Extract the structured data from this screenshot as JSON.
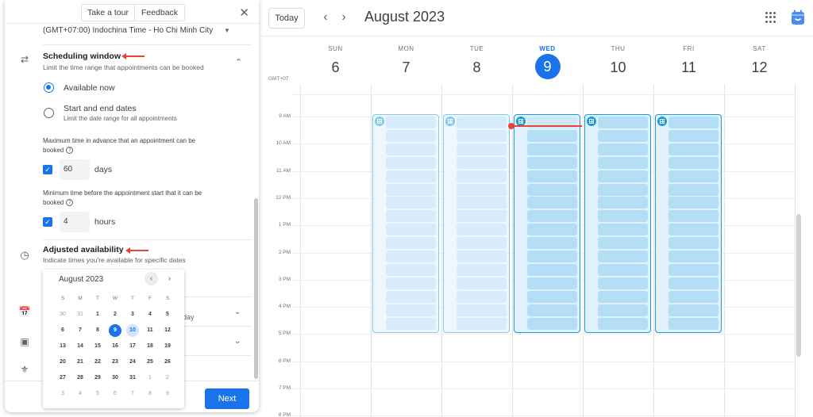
{
  "calendar": {
    "today_label": "Today",
    "prev_icon": "chevron-left-icon",
    "next_icon": "chevron-right-icon",
    "month_title": "August 2023",
    "apps_icon": "apps-grid-icon",
    "logo_icon": "calendar-logo-icon",
    "timezone": "GMT+07",
    "days": [
      {
        "dow": "SUN",
        "date": "6",
        "today": false
      },
      {
        "dow": "MON",
        "date": "7",
        "today": false
      },
      {
        "dow": "TUE",
        "date": "8",
        "today": false
      },
      {
        "dow": "WED",
        "date": "9",
        "today": true
      },
      {
        "dow": "THU",
        "date": "10",
        "today": false
      },
      {
        "dow": "FRI",
        "date": "11",
        "today": false
      },
      {
        "dow": "SAT",
        "date": "12",
        "today": false
      }
    ],
    "hours": [
      "9 AM",
      "10 AM",
      "11 AM",
      "12 PM",
      "1 PM",
      "2 PM",
      "3 PM",
      "4 PM",
      "5 PM",
      "6 PM",
      "7 PM",
      "8 PM"
    ],
    "availability": {
      "days": [
        "MON",
        "TUE",
        "WED",
        "THU",
        "FRI"
      ],
      "start": "9 AM",
      "end": "5 PM",
      "slot_minutes": 30,
      "slots_per_day": 16,
      "colors": {
        "past_border": "#7fcaf0",
        "future_border": "#1a9ae0",
        "past_slot": "#d7ecfa",
        "future_slot": "#b3def6"
      }
    },
    "current_time_indicator_color": "#ea4335"
  },
  "panel": {
    "take_tour_label": "Take a tour",
    "feedback_label": "Feedback",
    "close_icon": "close-icon",
    "timezone_value": "(GMT+07:00) Indochina Time - Ho Chi Minh City",
    "scheduling": {
      "title": "Scheduling window",
      "subtitle": "Limit the time range that appointments can be booked",
      "options": [
        {
          "label": "Available now",
          "selected": true
        },
        {
          "label": "Start and end dates",
          "sub": "Limit the date range for all appointments",
          "selected": false
        }
      ],
      "max_label_1": "Maximum time in advance that an appointment can be",
      "max_label_2": "booked",
      "max_value": "60",
      "max_unit": "days",
      "min_label_1": "Minimum time before the appointment start that it can be",
      "min_label_2": "booked",
      "min_value": "4",
      "min_unit": "hours"
    },
    "adjusted": {
      "title": "Adjusted availability",
      "subtitle": "Indicate times you're available for specific dates"
    },
    "hidden_row_text": "day",
    "next_label": "Next",
    "accent_color": "#1a73e8",
    "picker": {
      "title": "August 2023",
      "weekdays": [
        "S",
        "M",
        "T",
        "W",
        "T",
        "F",
        "S"
      ],
      "weeks": [
        [
          "30",
          "31",
          "1",
          "2",
          "3",
          "4",
          "5"
        ],
        [
          "6",
          "7",
          "8",
          "9",
          "10",
          "11",
          "12"
        ],
        [
          "13",
          "14",
          "15",
          "16",
          "17",
          "18",
          "19"
        ],
        [
          "20",
          "21",
          "22",
          "23",
          "24",
          "25",
          "26"
        ],
        [
          "27",
          "28",
          "29",
          "30",
          "31",
          "1",
          "2"
        ],
        [
          "3",
          "4",
          "5",
          "6",
          "7",
          "8",
          "9"
        ]
      ],
      "selected": "9",
      "highlighted": "10"
    }
  }
}
